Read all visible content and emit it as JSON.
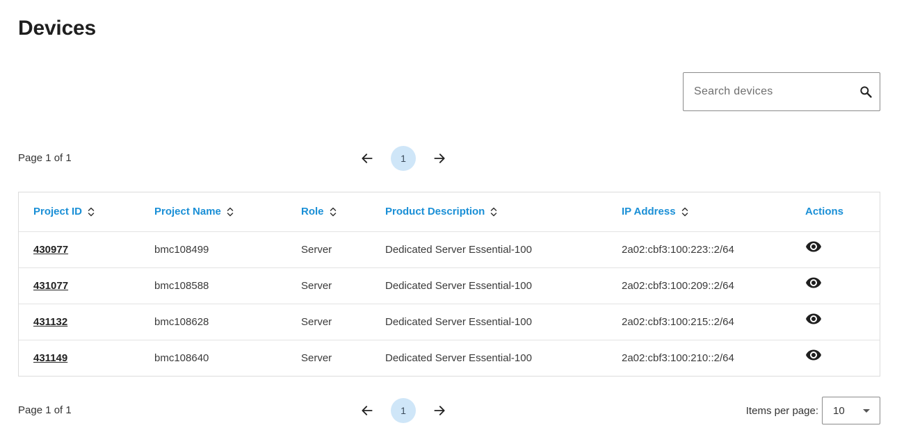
{
  "page": {
    "title": "Devices"
  },
  "search": {
    "placeholder": "Search devices",
    "icon": "search-icon"
  },
  "pagination": {
    "info": "Page 1 of 1",
    "current_page": "1",
    "prev_icon": "arrow-left-icon",
    "next_icon": "arrow-right-icon",
    "items_per_page_label": "Items per page:",
    "items_per_page_value": "10"
  },
  "table": {
    "columns": [
      {
        "label": "Project ID",
        "sortable": true
      },
      {
        "label": "Project Name",
        "sortable": true
      },
      {
        "label": "Role",
        "sortable": true
      },
      {
        "label": "Product Description",
        "sortable": true
      },
      {
        "label": "IP Address",
        "sortable": true
      },
      {
        "label": "Actions",
        "sortable": false
      }
    ],
    "rows": [
      {
        "project_id": "430977",
        "project_name": "bmc108499",
        "role": "Server",
        "product_description": "Dedicated Server Essential-100",
        "ip_address": "2a02:cbf3:100:223::2/64"
      },
      {
        "project_id": "431077",
        "project_name": "bmc108588",
        "role": "Server",
        "product_description": "Dedicated Server Essential-100",
        "ip_address": "2a02:cbf3:100:209::2/64"
      },
      {
        "project_id": "431132",
        "project_name": "bmc108628",
        "role": "Server",
        "product_description": "Dedicated Server Essential-100",
        "ip_address": "2a02:cbf3:100:215::2/64"
      },
      {
        "project_id": "431149",
        "project_name": "bmc108640",
        "role": "Server",
        "product_description": "Dedicated Server Essential-100",
        "ip_address": "2a02:cbf3:100:210::2/64"
      }
    ]
  },
  "colors": {
    "accent": "#1a8fd6",
    "page_highlight": "#cfe6f8",
    "text": "#222222"
  }
}
